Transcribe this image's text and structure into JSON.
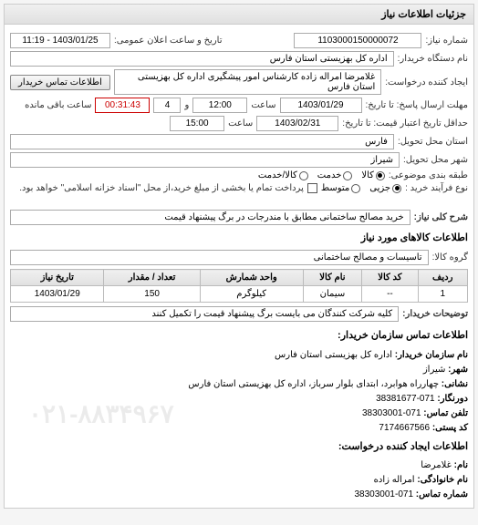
{
  "panel_title": "جزئیات اطلاعات نیاز",
  "request_number": {
    "label": "شماره نیاز:",
    "value": "1103000150000072"
  },
  "announce_date": {
    "label": "تاریخ و ساعت اعلان عمومی:",
    "value": "1403/01/25 - 11:19"
  },
  "buyer_org": {
    "label": "نام دستگاه خریدار:",
    "value": "اداره کل بهزیستی استان فارس"
  },
  "request_creator": {
    "label": "ایجاد کننده درخواست:",
    "value": "غلامرضا امراله زاده کارشناس امور پیشگیری اداره کل بهزیستی استان فارس"
  },
  "contact_btn": "اطلاعات تماس خریدار",
  "response_deadline": {
    "label": "مهلت ارسال پاسخ: تا تاریخ:",
    "date": "1403/01/29",
    "hour_label": "ساعت",
    "hour": "12:00",
    "day_label": "و",
    "days": "4",
    "remain_label": "ساعت باقی مانده",
    "remain": "00:31:43"
  },
  "validity": {
    "label": "حداقل تاریخ اعتبار قیمت: تا تاریخ:",
    "date": "1403/02/31",
    "hour_label": "ساعت",
    "hour": "15:00"
  },
  "delivery_province": {
    "label": "استان محل تحویل:",
    "value": "فارس"
  },
  "delivery_city": {
    "label": "شهر محل تحویل:",
    "value": "شیراز"
  },
  "category": {
    "label": "طبقه بندی موضوعی:",
    "options": [
      "کالا",
      "خدمت",
      "کالا/خدمت"
    ],
    "selected": 0
  },
  "purchase_type": {
    "label": "نوع فرآیند خرید :",
    "options": [
      "جزیی",
      "متوسط"
    ],
    "selected": 0,
    "checkbox_label": "پرداخت تمام یا بخشی از مبلغ خرید،از محل \"اسناد خزانه اسلامی\" خواهد بود."
  },
  "need_title": {
    "label": "شرح کلی نیاز:",
    "value": "خرید مصالح ساختمانی مطابق با مندرجات در برگ پیشنهاد قیمت"
  },
  "goods_section_title": "اطلاعات کالاهای مورد نیاز",
  "goods_group": {
    "label": "گروه کالا:",
    "value": "تاسیسات و مصالح ساختمانی"
  },
  "table": {
    "headers": [
      "ردیف",
      "کد کالا",
      "نام کالا",
      "واحد شمارش",
      "تعداد / مقدار",
      "تاریخ نیاز"
    ],
    "rows": [
      {
        "idx": "1",
        "code": "--",
        "name": "سیمان",
        "unit": "کیلوگرم",
        "qty": "150",
        "date": "1403/01/29"
      }
    ]
  },
  "buyer_notes": {
    "label": "توضیحات خریدار:",
    "value": "کلیه شرکت کنندگان می بایست برگ پیشنهاد قیمت را تکمیل کنند"
  },
  "contact_section_title": "اطلاعات تماس سازمان خریدار:",
  "contact": {
    "org_label": "نام سازمان خریدار:",
    "org": "اداره کل بهزیستی استان فارس",
    "city_label": "شهر:",
    "city": "شیراز",
    "addr_label": "نشانی:",
    "addr": "چهارراه هوابرد، ابتدای بلوار سرباز، اداره کل بهزیستی استان فارس",
    "pre_label": "دورنگار:",
    "pre": "071-38381677",
    "tel_label": "تلفن تماس:",
    "tel": "071-38303001",
    "post_label": "کد پستی:",
    "post": "7174667566"
  },
  "creator_section_title": "اطلاعات ایجاد کننده درخواست:",
  "creator": {
    "fname_label": "نام:",
    "fname": "غلامرضا",
    "lname_label": "نام خانوادگی:",
    "lname": "امراله زاده",
    "tel_label": "شماره تماس:",
    "tel": "071-38303001"
  },
  "watermark": "۰۲۱-۸۸۳۴۹۶۷"
}
